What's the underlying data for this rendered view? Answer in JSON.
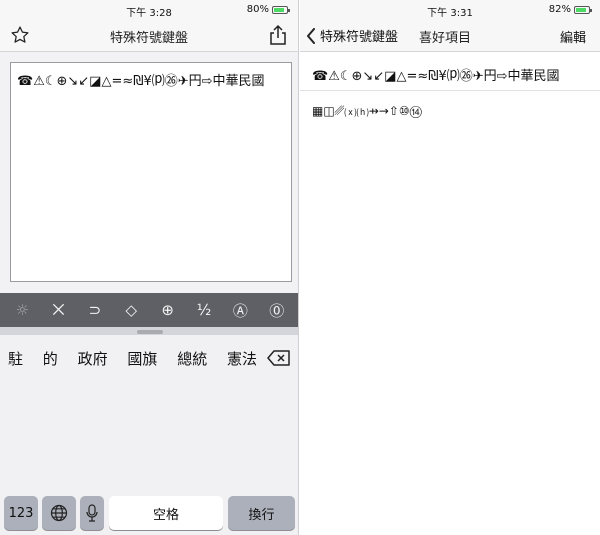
{
  "left": {
    "status": {
      "time": "下午 3:28",
      "battery": "80%",
      "battery_level": 0.8
    },
    "nav": {
      "title": "特殊符號鍵盤",
      "favorite_icon": "star-icon",
      "share_icon": "share-icon"
    },
    "editor_text": "☎⚠☾⊕↘↙◪△=≈₪¥⒫㉖✈円⇨中華民國",
    "symbol_tabs": [
      "☼",
      "⨉",
      "⊃",
      "◇",
      "⊕",
      "½",
      "Ⓐ",
      "⓪"
    ],
    "suggestions": [
      "駐",
      "的",
      "政府",
      "國旗",
      "總統",
      "憲法"
    ],
    "keys": {
      "numbers": "123",
      "space": "空格",
      "return": "換行"
    }
  },
  "right": {
    "status": {
      "time": "下午 3:31",
      "battery": "82%",
      "battery_level": 0.82
    },
    "nav": {
      "back_label": "特殊符號鍵盤",
      "title": "喜好項目",
      "edit_label": "編輯"
    },
    "favorites": [
      "☎⚠☾⊕↘↙◪△=≈₪¥⒫㉖✈円⇨中華民國",
      "▦◫␥⒳⒣⇸→⇧⑩⑭"
    ]
  }
}
